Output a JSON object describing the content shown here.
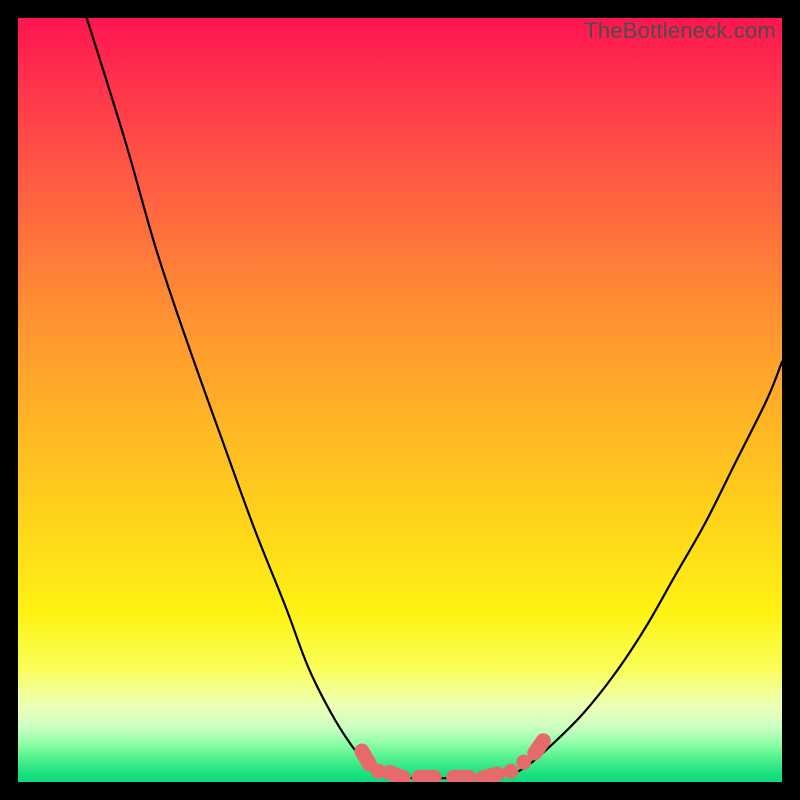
{
  "watermark": "TheBottleneck.com",
  "colors": {
    "frame": "#000000",
    "curve_black": "#000000",
    "marker_red": "#e76a6a",
    "marker_outline": "#d95b5b"
  },
  "chart_data": {
    "type": "line",
    "title": "",
    "xlabel": "",
    "ylabel": "",
    "xlim": [
      0,
      100
    ],
    "ylim": [
      0,
      100
    ],
    "grid": false,
    "legend": false,
    "series": [
      {
        "name": "left-branch",
        "x": [
          9,
          14,
          18,
          22,
          27,
          31,
          35,
          38,
          41,
          43.5,
          45.5,
          47
        ],
        "values": [
          100,
          84,
          70,
          58,
          44,
          33,
          23,
          15,
          9,
          5,
          2.5,
          1
        ]
      },
      {
        "name": "valley",
        "x": [
          47,
          50,
          55,
          60,
          64,
          66.5
        ],
        "values": [
          1,
          0.6,
          0.5,
          0.6,
          1,
          2
        ]
      },
      {
        "name": "right-branch",
        "x": [
          66.5,
          70,
          74,
          78,
          82,
          86,
          90,
          94,
          98,
          100
        ],
        "values": [
          2,
          5,
          9,
          14,
          20,
          27,
          34,
          42,
          50,
          55
        ]
      }
    ],
    "markers": {
      "name": "highlight-beads",
      "points": [
        {
          "x": 45.5,
          "y": 3.2,
          "shape": "rounded",
          "angle": 60
        },
        {
          "x": 47.2,
          "y": 1.4,
          "shape": "circle"
        },
        {
          "x": 49.5,
          "y": 0.9,
          "shape": "rounded",
          "angle": 20
        },
        {
          "x": 53.5,
          "y": 0.6,
          "shape": "rounded",
          "angle": 0
        },
        {
          "x": 58.0,
          "y": 0.6,
          "shape": "rounded",
          "angle": 0
        },
        {
          "x": 61.8,
          "y": 0.8,
          "shape": "rounded",
          "angle": -15
        },
        {
          "x": 64.5,
          "y": 1.4,
          "shape": "circle"
        },
        {
          "x": 66.2,
          "y": 2.6,
          "shape": "circle"
        },
        {
          "x": 68.2,
          "y": 4.6,
          "shape": "rounded",
          "angle": -55
        }
      ]
    }
  }
}
